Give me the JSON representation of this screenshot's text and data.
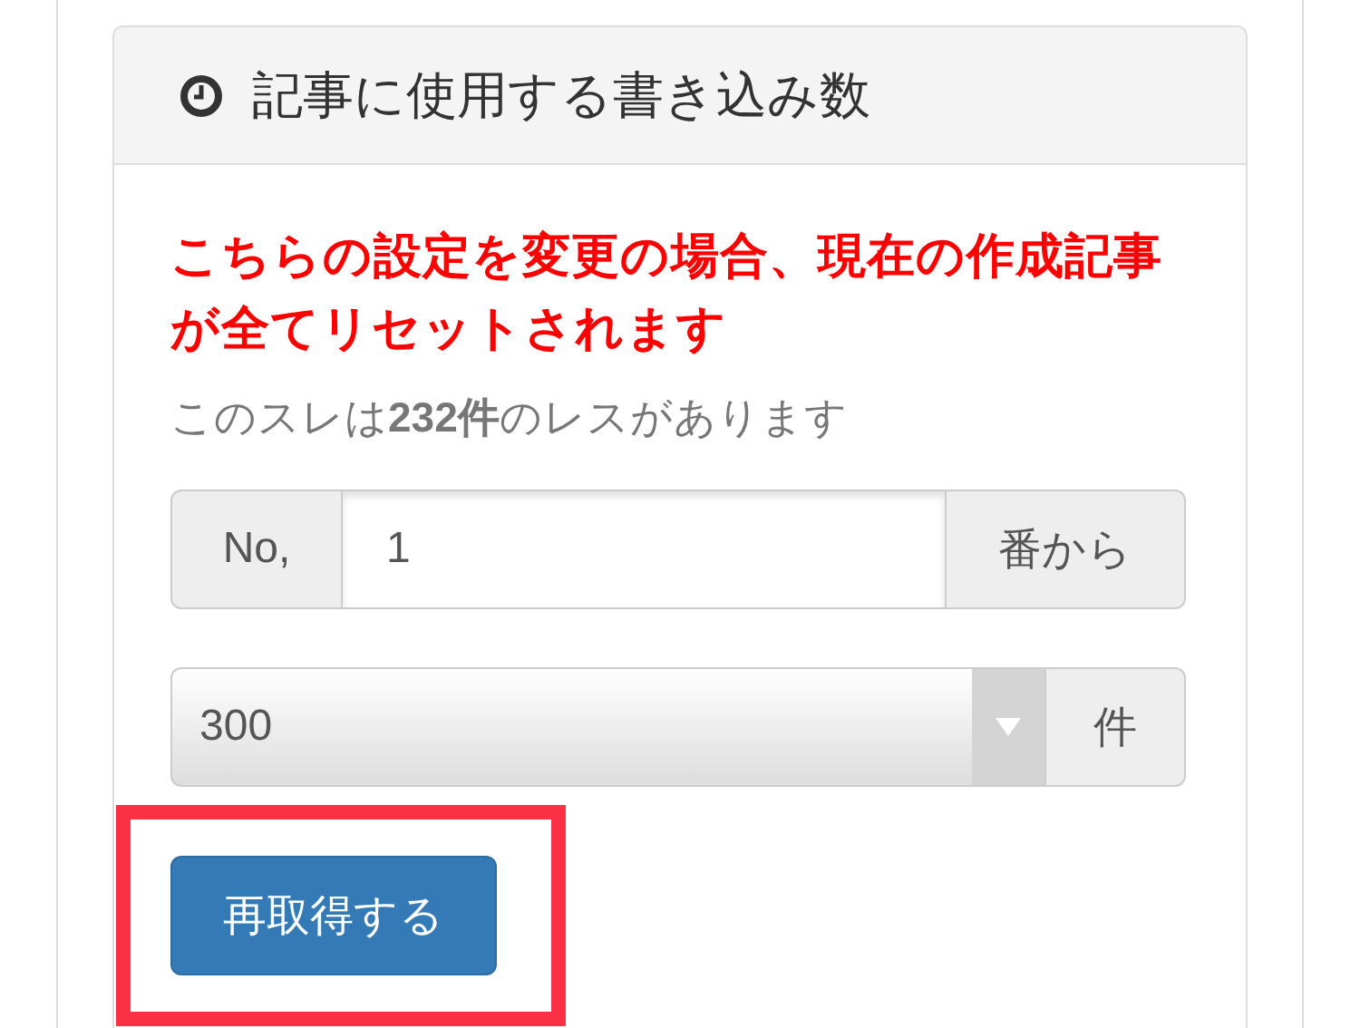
{
  "panel": {
    "title": "記事に使用する書き込み数"
  },
  "warning": "こちらの設定を変更の場合、現在の作成記事が全てリセットされます",
  "info": "このスレは**232件**のレスがあります",
  "start_field": {
    "prefix": "No,",
    "value": "1",
    "suffix": "番から"
  },
  "count_select": {
    "value": "300",
    "suffix": "件"
  },
  "button": {
    "label": "再取得する",
    "highlighted": true
  }
}
